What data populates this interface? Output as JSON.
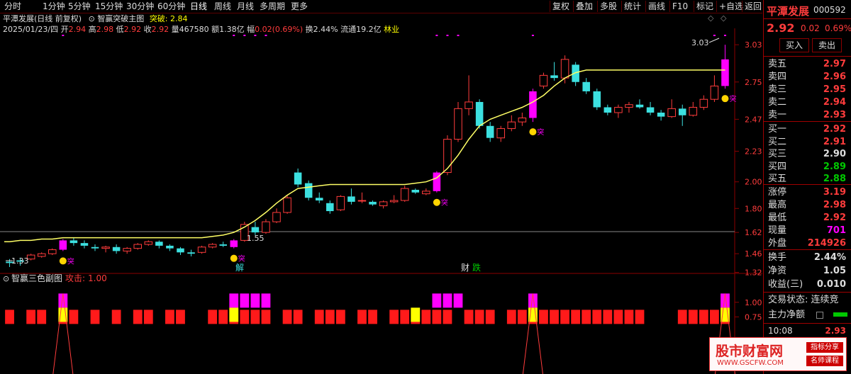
{
  "menu": {
    "periods": [
      "分时",
      "1分钟",
      "5分钟",
      "15分钟",
      "30分钟",
      "60分钟",
      "日线",
      "周线",
      "月线",
      "多周期",
      "更多"
    ],
    "active_period": "日线",
    "tools": [
      "复权",
      "叠加",
      "多股",
      "统计",
      "画线",
      "F10",
      "标记",
      "+自选",
      "返回"
    ]
  },
  "chart_header": {
    "stock_title": "平潭发展(日线 前复权)",
    "indicator_name": "智赢突破主图",
    "indicator_label": "突破:",
    "indicator_value": "2.84"
  },
  "bar_info": {
    "date": "2025/01/23/四",
    "open_label": "开",
    "open": "2.94",
    "high_label": "高",
    "high": "2.98",
    "low_label": "低",
    "low": "2.92",
    "close_label": "收",
    "close": "2.92",
    "volume_label": "量",
    "volume": "467580",
    "amount_label": "额",
    "amount": "1.38亿",
    "change_label": "幅",
    "change": "0.02(0.69%)",
    "turnover_label": "换",
    "turnover": "2.44%",
    "float_label": "流通",
    "float": "19.2亿",
    "industry": "林业"
  },
  "sub_header": {
    "name": "智赢三色副图",
    "label": "攻击:",
    "value": "1.00"
  },
  "annotations": {
    "breakout": "突",
    "max_price": "3.03",
    "min_price": "1.33",
    "mid_price": "1.55",
    "event_jie": "解",
    "event_cai": "财",
    "event_die": "跌"
  },
  "colors": {
    "up": "#ff3c3c",
    "down": "#3ce0e0",
    "limit_up": "#ff00ff",
    "ma": "#ffff66",
    "grid": "#8b0000"
  },
  "chart_data": {
    "type": "candlestick",
    "y_axis_ticks": [
      3.03,
      2.75,
      2.47,
      2.23,
      2.0,
      1.8,
      1.62,
      1.46,
      1.32
    ],
    "ylim": [
      1.28,
      3.1
    ],
    "sub_y_axis_ticks": [
      1.0,
      0.75
    ],
    "sub_ylim": [
      0.5,
      1.3
    ],
    "candles": [
      [
        1.4,
        1.42,
        1.36,
        1.39
      ],
      [
        1.41,
        1.43,
        1.37,
        1.4
      ],
      [
        1.42,
        1.46,
        1.41,
        1.45
      ],
      [
        1.44,
        1.47,
        1.43,
        1.46
      ],
      [
        1.46,
        1.5,
        1.45,
        1.49
      ],
      [
        1.49,
        1.57,
        1.48,
        1.56
      ],
      [
        1.56,
        1.58,
        1.52,
        1.54
      ],
      [
        1.54,
        1.56,
        1.5,
        1.52
      ],
      [
        1.51,
        1.53,
        1.48,
        1.5
      ],
      [
        1.5,
        1.52,
        1.47,
        1.51
      ],
      [
        1.51,
        1.53,
        1.46,
        1.48
      ],
      [
        1.48,
        1.51,
        1.46,
        1.5
      ],
      [
        1.5,
        1.54,
        1.49,
        1.53
      ],
      [
        1.53,
        1.56,
        1.52,
        1.55
      ],
      [
        1.55,
        1.56,
        1.5,
        1.52
      ],
      [
        1.52,
        1.53,
        1.48,
        1.5
      ],
      [
        1.5,
        1.51,
        1.45,
        1.47
      ],
      [
        1.47,
        1.49,
        1.44,
        1.46
      ],
      [
        1.47,
        1.52,
        1.46,
        1.51
      ],
      [
        1.51,
        1.54,
        1.5,
        1.53
      ],
      [
        1.53,
        1.55,
        1.51,
        1.52
      ],
      [
        1.51,
        1.57,
        1.5,
        1.56
      ],
      [
        1.56,
        1.7,
        1.55,
        1.68
      ],
      [
        1.66,
        1.7,
        1.6,
        1.62
      ],
      [
        1.62,
        1.72,
        1.61,
        1.7
      ],
      [
        1.7,
        1.8,
        1.69,
        1.77
      ],
      [
        1.77,
        1.9,
        1.76,
        1.88
      ],
      [
        2.07,
        2.1,
        1.96,
        1.98
      ],
      [
        1.99,
        2.01,
        1.86,
        1.88
      ],
      [
        1.88,
        1.92,
        1.84,
        1.86
      ],
      [
        1.84,
        1.86,
        1.76,
        1.78
      ],
      [
        1.79,
        1.9,
        1.78,
        1.89
      ],
      [
        1.89,
        1.95,
        1.83,
        1.85
      ],
      [
        1.86,
        1.92,
        1.84,
        1.86
      ],
      [
        1.85,
        1.86,
        1.82,
        1.83
      ],
      [
        1.82,
        1.86,
        1.8,
        1.85
      ],
      [
        1.85,
        1.9,
        1.84,
        1.86
      ],
      [
        1.86,
        1.97,
        1.85,
        1.95
      ],
      [
        1.94,
        1.95,
        1.91,
        1.92
      ],
      [
        1.91,
        1.95,
        1.9,
        1.93
      ],
      [
        1.93,
        2.08,
        1.92,
        2.07
      ],
      [
        2.07,
        2.35,
        2.05,
        2.32
      ],
      [
        2.32,
        2.6,
        2.3,
        2.55
      ],
      [
        2.55,
        2.8,
        2.5,
        2.6
      ],
      [
        2.6,
        2.62,
        2.4,
        2.42
      ],
      [
        2.42,
        2.45,
        2.3,
        2.33
      ],
      [
        2.33,
        2.42,
        2.3,
        2.4
      ],
      [
        2.4,
        2.5,
        2.38,
        2.45
      ],
      [
        2.45,
        2.52,
        2.42,
        2.48
      ],
      [
        2.48,
        2.7,
        2.45,
        2.68
      ],
      [
        2.72,
        2.82,
        2.7,
        2.8
      ],
      [
        2.8,
        2.9,
        2.76,
        2.78
      ],
      [
        2.78,
        2.95,
        2.74,
        2.92
      ],
      [
        2.88,
        2.9,
        2.72,
        2.75
      ],
      [
        2.75,
        2.78,
        2.66,
        2.68
      ],
      [
        2.68,
        2.7,
        2.54,
        2.56
      ],
      [
        2.56,
        2.58,
        2.5,
        2.52
      ],
      [
        2.52,
        2.58,
        2.48,
        2.56
      ],
      [
        2.56,
        2.6,
        2.52,
        2.58
      ],
      [
        2.58,
        2.62,
        2.55,
        2.56
      ],
      [
        2.56,
        2.6,
        2.5,
        2.52
      ],
      [
        2.52,
        2.54,
        2.46,
        2.49
      ],
      [
        2.49,
        2.62,
        2.48,
        2.55
      ],
      [
        2.55,
        2.58,
        2.42,
        2.5
      ],
      [
        2.5,
        2.6,
        2.49,
        2.56
      ],
      [
        2.56,
        2.65,
        2.54,
        2.62
      ],
      [
        2.62,
        2.8,
        2.6,
        2.72
      ],
      [
        2.72,
        3.03,
        2.7,
        2.92
      ]
    ],
    "ma_values": [
      1.55,
      1.56,
      1.56,
      1.57,
      1.57,
      1.58,
      1.58,
      1.58,
      1.58,
      1.58,
      1.58,
      1.58,
      1.58,
      1.58,
      1.58,
      1.58,
      1.58,
      1.58,
      1.58,
      1.59,
      1.6,
      1.62,
      1.66,
      1.71,
      1.77,
      1.84,
      1.9,
      1.95,
      1.96,
      1.97,
      1.98,
      1.98,
      1.98,
      1.98,
      1.98,
      1.98,
      1.98,
      1.98,
      1.99,
      2.0,
      2.03,
      2.1,
      2.2,
      2.32,
      2.42,
      2.47,
      2.5,
      2.53,
      2.56,
      2.6,
      2.65,
      2.72,
      2.78,
      2.82,
      2.84,
      2.84,
      2.84,
      2.84,
      2.84,
      2.84,
      2.84,
      2.84,
      2.84,
      2.84,
      2.84,
      2.84,
      2.84,
      2.84
    ],
    "limit_up_days": [
      5,
      21,
      40,
      49,
      67
    ],
    "breakout_days": [
      5,
      21,
      40,
      49,
      67
    ],
    "sub_attack_days": [
      5,
      21,
      22,
      23,
      24,
      40,
      41,
      42,
      49,
      67
    ],
    "sub_yellow_days": [
      5,
      21,
      38,
      49,
      67
    ],
    "sub_red_blocks": [
      0,
      2,
      3,
      5,
      6,
      8,
      10,
      12,
      13,
      15,
      16,
      19,
      20,
      21,
      22,
      23,
      24,
      26,
      27,
      29,
      30,
      31,
      33,
      34,
      36,
      37,
      38,
      39,
      40,
      41,
      43,
      44,
      45,
      47,
      48,
      49,
      50,
      51,
      52,
      53,
      54,
      55,
      56,
      57,
      58,
      59,
      63,
      64,
      65,
      66,
      67
    ]
  },
  "right_panel": {
    "name": "平潭发展",
    "code": "000592",
    "price": "2.92",
    "change": "0.02",
    "pct": "0.69%",
    "buy_btn": "买入",
    "sell_btn": "卖出",
    "asks": [
      {
        "label": "卖五",
        "price": "2.97"
      },
      {
        "label": "卖四",
        "price": "2.96"
      },
      {
        "label": "卖三",
        "price": "2.95"
      },
      {
        "label": "卖二",
        "price": "2.94"
      },
      {
        "label": "卖一",
        "price": "2.93"
      }
    ],
    "bids": [
      {
        "label": "买一",
        "price": "2.92"
      },
      {
        "label": "买二",
        "price": "2.91"
      },
      {
        "label": "买三",
        "price": "2.90"
      },
      {
        "label": "买四",
        "price": "2.89"
      },
      {
        "label": "买五",
        "price": "2.88"
      }
    ],
    "stats": [
      {
        "label": "涨停",
        "value": "3.19"
      },
      {
        "label": "最高",
        "value": "2.98"
      },
      {
        "label": "最低",
        "value": "2.92"
      },
      {
        "label": "现量",
        "value": "701"
      },
      {
        "label": "外盘",
        "value": "214926"
      }
    ],
    "stats2": [
      {
        "label": "换手",
        "value": "2.44%"
      },
      {
        "label": "净资",
        "value": "1.05"
      },
      {
        "label": "收益(三)",
        "value": "0.010"
      }
    ],
    "trade_status": "交易状态: 连续竞",
    "main_flow": "主力净额",
    "time": "10:08",
    "tick_price": "2.93"
  },
  "watermark": {
    "title": "股市财富网",
    "url": "WWW.GSCFW.COM",
    "badge1": "指标分享",
    "badge2": "名师课程"
  }
}
